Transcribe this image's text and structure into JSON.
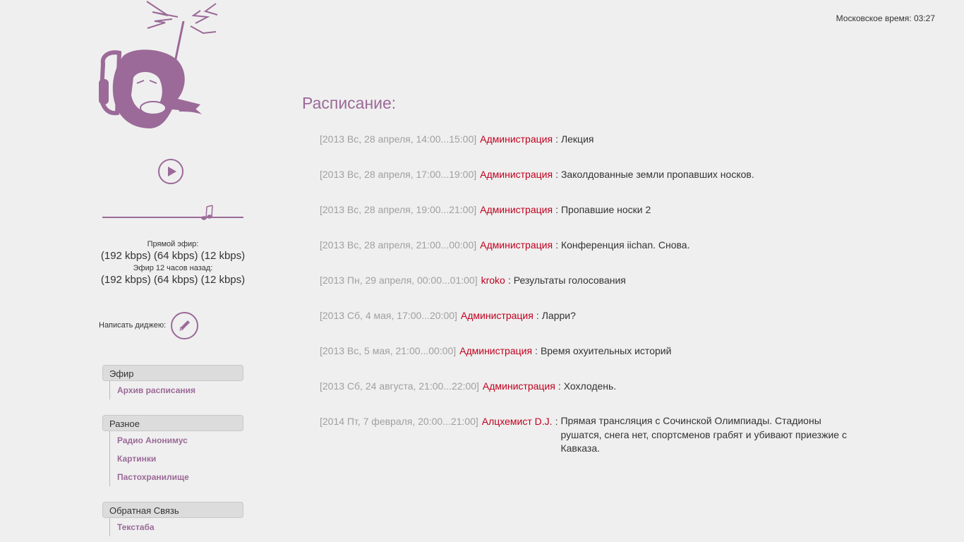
{
  "header": {
    "clock": "Московское время: 03:27"
  },
  "colors": {
    "accent": "#9b6a98",
    "author": "#c0001e",
    "date": "#a0a0a0",
    "background": "#efefef"
  },
  "player": {
    "play_icon": "play-icon",
    "volume_icon": "music-note-icon"
  },
  "stream": {
    "live_caption": "Прямой эфир:",
    "live_links": [
      "(192 kbps)",
      "(64 kbps)",
      "(12 kbps)"
    ],
    "archive_caption": "Эфир 12 часов назад:",
    "archive_links": [
      "(192 kbps)",
      "(64 kbps)",
      "(12 kbps)"
    ]
  },
  "write_dj": {
    "label": "Написать диджею:",
    "icon": "pencil-icon"
  },
  "menus": [
    {
      "title": "Эфир",
      "items": [
        "Архив расписания"
      ]
    },
    {
      "title": "Разное",
      "items": [
        "Радио Анонимус",
        "Картинки",
        "Пастохранилище"
      ]
    },
    {
      "title": "Обратная Связь",
      "items": [
        "Текстаба"
      ]
    }
  ],
  "schedule": {
    "title": "Расписание:",
    "separator": ":",
    "entries": [
      {
        "date": "[2013 Вс, 28 апреля, 14:00...15:00]",
        "author": "Администрация",
        "event": "Лекция"
      },
      {
        "date": "[2013 Вс, 28 апреля, 17:00...19:00]",
        "author": "Администрация",
        "event": "Заколдованные земли пропавших носков."
      },
      {
        "date": "[2013 Вс, 28 апреля, 19:00...21:00]",
        "author": "Администрация",
        "event": "Пропавшие носки 2"
      },
      {
        "date": "[2013 Вс, 28 апреля, 21:00...00:00]",
        "author": "Администрация",
        "event": "Конференция iichan. Снова."
      },
      {
        "date": "[2013 Пн, 29 апреля, 00:00...01:00]",
        "author": "kroko",
        "event": "Результаты голосования"
      },
      {
        "date": "[2013 Сб, 4 мая, 17:00...20:00]",
        "author": "Администрация",
        "event": "Ларри?"
      },
      {
        "date": "[2013 Вс, 5 мая, 21:00...00:00]",
        "author": "Администрация",
        "event": "Время охуительных историй"
      },
      {
        "date": "[2013 Сб, 24 августа, 21:00...22:00]",
        "author": "Администрация",
        "event": "Хохлодень."
      },
      {
        "date": "[2014 Пт, 7 февраля, 20:00...21:00]",
        "author": "Алцхемист D.J.",
        "event": "Прямая трансляция с Сочинской Олимпиады. Стадионы рушатся, снега нет, спортсменов грабят и убивают приезжие с Кавказа."
      }
    ]
  }
}
